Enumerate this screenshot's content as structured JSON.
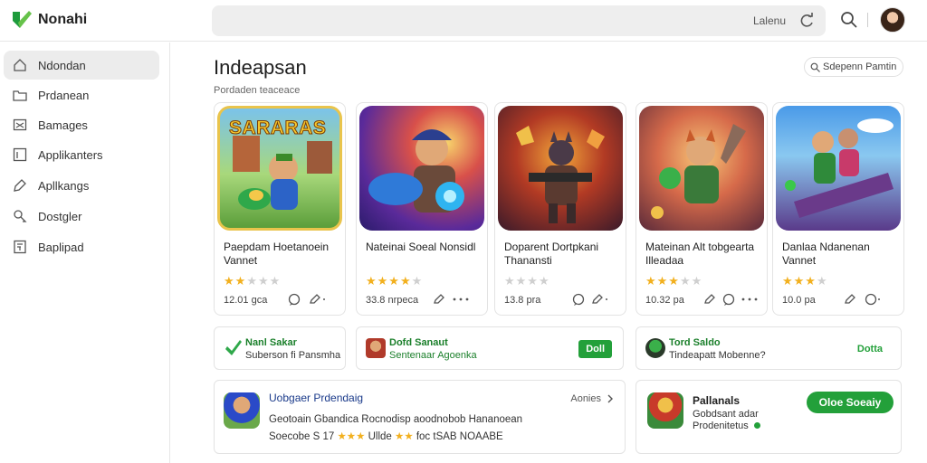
{
  "header": {
    "brand": "Nonahi",
    "search_label": "Lalenu",
    "icons": [
      "check-logo-icon",
      "refresh-icon",
      "search-icon"
    ]
  },
  "sidebar": {
    "items": [
      {
        "label": "Ndondan",
        "icon": "home-icon"
      },
      {
        "label": "Prdanean",
        "icon": "folder-icon"
      },
      {
        "label": "Bamages",
        "icon": "image-icon"
      },
      {
        "label": "Applikanters",
        "icon": "apps-icon"
      },
      {
        "label": "Apllkangs",
        "icon": "tag-icon"
      },
      {
        "label": "Dostgler",
        "icon": "search-doc-icon"
      },
      {
        "label": "Baplipad",
        "icon": "pad-icon"
      }
    ]
  },
  "main": {
    "title": "Indeapsan",
    "subtitle": "Pordaden teaceace",
    "sort_label": "Sdepenn Pamtin"
  },
  "apps": [
    {
      "name": "Paepdam Hoetanoein Vannet",
      "rating": 2,
      "meta": "12.01 gca",
      "art_title": "SARARAS"
    },
    {
      "name": "Nateinai Soeal Nonsidl",
      "rating": 4,
      "meta": "33.8 nrpeca",
      "art_title": ""
    },
    {
      "name": "Doparent Dortpkani Thanansti",
      "rating": 0,
      "meta": "13.8 pra",
      "art_title": ""
    },
    {
      "name": "Mateinan Alt tobgearta Illeadaa",
      "rating": 3,
      "meta": "10.32 pa",
      "art_title": ""
    },
    {
      "name": "Danlaa Ndanenan Vannet",
      "rating": 3,
      "meta": "10.0 pa",
      "art_title": ""
    }
  ],
  "promos": [
    {
      "title": "Nanl Sakar",
      "subtitle": "Suberson fi Pansmha",
      "button": ""
    },
    {
      "title": "Dofd Sanaut",
      "subtitle": "Sentenaar Agoenka",
      "button": "Doll"
    },
    {
      "title": "Tord Saldo",
      "subtitle": "Tindeapatt Mobenne?",
      "button": "Dotta"
    }
  ],
  "bottom_left": {
    "title": "Uobgaer Prdendaig",
    "link": "Aonies",
    "line1": "Geotoain Gbandica Rocnodisp aoodnobob Hananoean",
    "line2": "Soecobe S 17",
    "line2b": "Ullde",
    "line2c": "foc tSAB NOAABE"
  },
  "bottom_right": {
    "title": "Pallanals",
    "line1": "Gobdsant adar",
    "line2": "Prodenitetus",
    "cta": "Oloe Soeaiy"
  },
  "colors": {
    "accent_green": "#23a03a",
    "star": "#f2b01e",
    "promo_title": "#1a7f2a"
  }
}
